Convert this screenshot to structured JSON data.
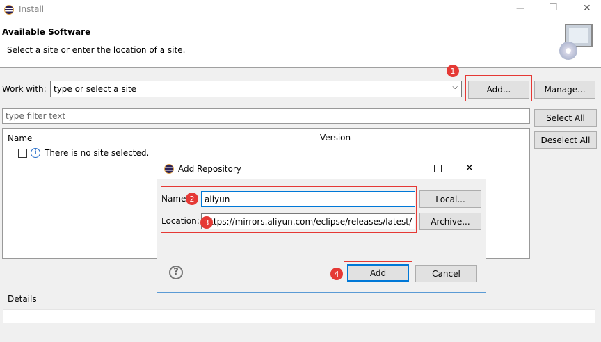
{
  "window": {
    "title": "Install",
    "controls": {
      "minimize": "—",
      "maximize": "☐",
      "close": "✕"
    }
  },
  "header": {
    "title": "Available Software",
    "subtitle": "Select a site or enter the location of a site."
  },
  "work_with": {
    "label": "Work with:",
    "placeholder": "type or select a site",
    "add": "Add...",
    "manage": "Manage..."
  },
  "filter": {
    "placeholder": "type filter text"
  },
  "side_buttons": {
    "select_all": "Select All",
    "deselect_all": "Deselect All"
  },
  "table": {
    "columns": [
      "Name",
      "Version"
    ],
    "message": "There is no site selected."
  },
  "details": {
    "label": "Details"
  },
  "dialog": {
    "title": "Add Repository",
    "name_label": "Name:",
    "name_value": "aliyun",
    "location_label": "Location:",
    "location_value": "https://mirrors.aliyun.com/eclipse/releases/latest/",
    "local": "Local...",
    "archive": "Archive...",
    "add": "Add",
    "cancel": "Cancel",
    "help": "?"
  },
  "badges": [
    "1",
    "2",
    "3",
    "4"
  ],
  "colors": {
    "accent": "#0078d7",
    "annotation": "#e53935"
  }
}
